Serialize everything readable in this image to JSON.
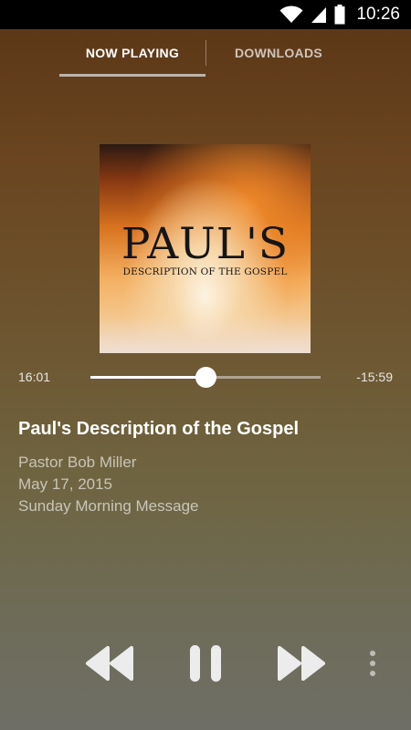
{
  "status_bar": {
    "time": "10:26",
    "icons": [
      "wifi-icon",
      "cell-signal-icon",
      "battery-icon"
    ]
  },
  "tabs": [
    {
      "label": "NOW PLAYING",
      "selected": true
    },
    {
      "label": "DOWNLOADS",
      "selected": false
    }
  ],
  "artwork": {
    "title": "PAUL'S",
    "subtitle": "DESCRIPTION OF THE GOSPEL"
  },
  "player": {
    "elapsed": "16:01",
    "remaining": "-15:59",
    "progress": 0.5
  },
  "track": {
    "title": "Paul's Description of the Gospel",
    "speaker": "Pastor Bob Miller",
    "date": "May 17, 2015",
    "series": "Sunday Morning Message"
  },
  "controls": {
    "icons": [
      "rewind-icon",
      "pause-icon",
      "fast-forward-icon",
      "more-vert-icon"
    ]
  },
  "colors": {
    "status_bar": "#000000",
    "accent": "#ffffff"
  }
}
